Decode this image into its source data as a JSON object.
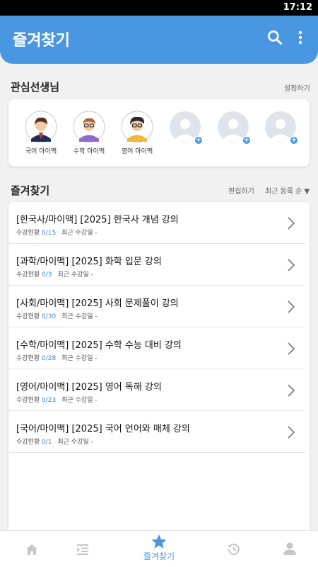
{
  "status": {
    "time": "17:12"
  },
  "header": {
    "title": "즐겨찾기",
    "search_icon": "search-icon",
    "more_icon": "more-vert-icon"
  },
  "teachers_section": {
    "title": "관심선생님",
    "settings_label": "설정하기",
    "teachers": [
      {
        "name": "국어 마이맥",
        "icon": "teacher-avatar-korean"
      },
      {
        "name": "수학 마이맥",
        "icon": "teacher-avatar-math"
      },
      {
        "name": "영어 마이맥",
        "icon": "teacher-avatar-english"
      },
      {
        "name": "",
        "icon": "add-teacher-placeholder"
      },
      {
        "name": "",
        "icon": "add-teacher-placeholder"
      },
      {
        "name": "",
        "icon": "add-teacher-placeholder"
      }
    ]
  },
  "favorites_section": {
    "title": "즐겨찾기",
    "edit_label": "편집하기",
    "sort_label": "최근 등록 순 ▼",
    "status_label": "수강현황",
    "courses": [
      {
        "title": "[한국사/마이맥] [2025] 한국사 개념 강의",
        "progress": "0/15",
        "recent": "최근 수강일 -"
      },
      {
        "title": "[과학/마이맥] [2025] 화학 입문 강의",
        "progress": "0/3",
        "recent": "최근 수강일 -"
      },
      {
        "title": "[사회/마이맥] [2025] 사회 문제풀이 강의",
        "progress": "0/30",
        "recent": "최근 수강일 -"
      },
      {
        "title": "[수학/마이맥] [2025] 수학 수능 대비 강의",
        "progress": "0/28",
        "recent": "최근 수강일 -"
      },
      {
        "title": "[영어/마이맥] [2025] 영어 독해 강의",
        "progress": "0/23",
        "recent": "최근 수강일 -"
      },
      {
        "title": "[국어/마이맥] [2025] 국어 언어와 매체 강의",
        "progress": "0/1",
        "recent": "최근 수강일 -"
      }
    ]
  },
  "bottom_nav": {
    "active_label": "즐겨찾기",
    "items": [
      "home-icon",
      "list-icon",
      "star-icon",
      "history-icon",
      "person-icon"
    ]
  },
  "colors": {
    "accent": "#4a97e1",
    "progress": "#3b86d6"
  }
}
